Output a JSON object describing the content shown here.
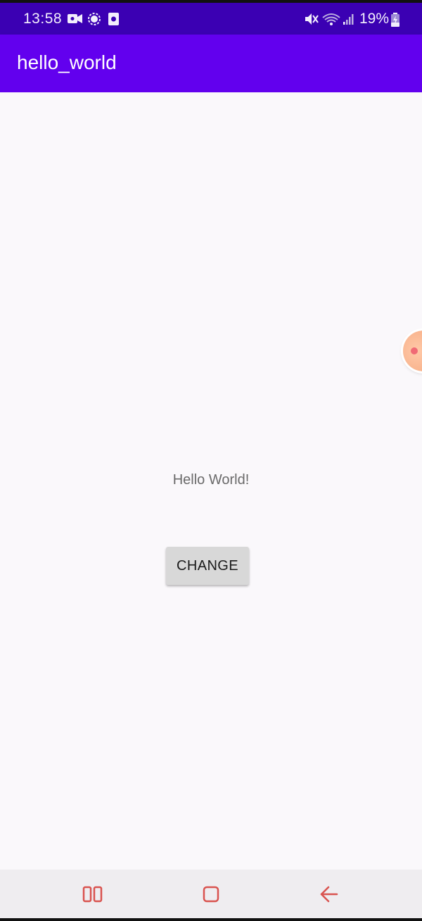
{
  "status_bar": {
    "time": "13:58",
    "battery_percent": "19%",
    "left_icons": [
      "video-recorder-icon",
      "signal-app-icon",
      "screenshot-icon"
    ],
    "right_icons": [
      "mute-icon",
      "wifi-icon",
      "cell-signal-icon",
      "battery-charging-icon"
    ]
  },
  "app_bar": {
    "title": "hello_world",
    "color": "#6200ee"
  },
  "main": {
    "message": "Hello World!",
    "button_label": "CHANGE"
  },
  "nav_bar": {
    "items": [
      "recent-apps-icon",
      "home-icon",
      "back-icon"
    ],
    "color": "#d9534f"
  },
  "colors": {
    "status_bar": "#3b00b3",
    "background": "#faf8fb",
    "button": "#d8d8d8"
  }
}
